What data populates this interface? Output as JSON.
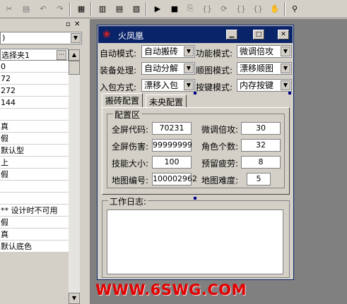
{
  "toolbar": {
    "icons": [
      "cut-icon",
      "paste-icon",
      "undo-icon",
      "redo-icon",
      "view-code-icon",
      "layout-icon",
      "grid-icon",
      "tab-order-icon",
      "run-icon",
      "stop-icon",
      "compile-icon",
      "braces-icon",
      "step-icon",
      "step-into-icon",
      "step-out-icon",
      "hand-icon",
      "find-icon"
    ],
    "enabled": [
      "view-code-icon",
      "layout-icon",
      "grid-icon",
      "tab-order-icon",
      "run-icon",
      "stop-icon",
      "find-icon"
    ]
  },
  "properties": {
    "selector": "选择夹1",
    "rows": [
      "0",
      "72",
      "272",
      "144",
      "",
      "真",
      "假",
      "默认型",
      "上",
      "假",
      "",
      "",
      "** 设计时不可用",
      "假",
      "真",
      "默认底色"
    ]
  },
  "form": {
    "title": "火凤凰",
    "labels": {
      "auto_mode": "自动模式:",
      "function_mode": "功能模式:",
      "equip_handle": "装备处理:",
      "map_mode": "顺图模式:",
      "bag_mode": "入包方式:",
      "key_mode": "按键模式:"
    },
    "dropdowns": {
      "auto_mode": "自动搬砖",
      "function_mode": "微调倍攻",
      "equip_handle": "自动分解",
      "map_mode": "漂移顺图",
      "bag_mode": "漂移入包",
      "key_mode": "内存按键"
    },
    "tabs": [
      "搬砖配置",
      "未央配置"
    ],
    "config": {
      "group_label": "配置区",
      "fullscreen_code_label": "全屏代码:",
      "fullscreen_code": "70231",
      "damage_multiplier_label": "微调倍攻:",
      "damage_multiplier": "30",
      "fullscreen_damage_label": "全屏伤害:",
      "fullscreen_damage": "99999999",
      "character_count_label": "角色个数:",
      "character_count": "32",
      "skill_size_label": "技能大小:",
      "skill_size": "100",
      "reserve_fatigue_label": "预留疲劳:",
      "reserve_fatigue": "8",
      "map_id_label": "地图编号:",
      "map_id": "100002962",
      "map_difficulty_label": "地图难度:",
      "map_difficulty": "5"
    },
    "log_label": "工作日志:"
  },
  "watermark": "WWW.6SWG.COM",
  "colors": {
    "titlebar": "#0a246a",
    "face": "#d4d0c8",
    "workspace": "#808080",
    "watermark": "#e00000"
  }
}
